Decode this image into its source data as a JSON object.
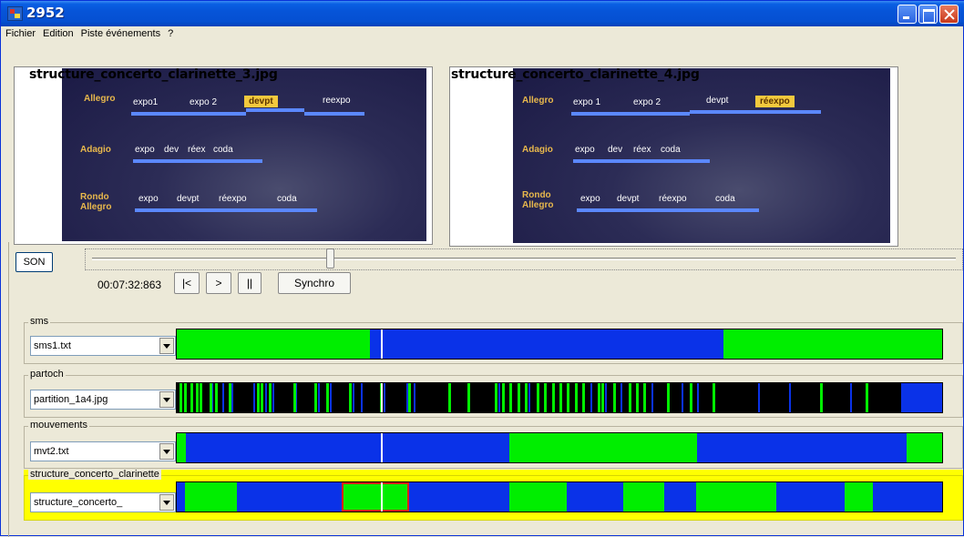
{
  "window": {
    "title": "2952",
    "icon": "app-icon"
  },
  "menu": [
    "Fichier",
    "Edition",
    "Piste événements",
    "?"
  ],
  "panels": [
    {
      "title": "structure_concerto_clarinette_3.jpg",
      "rows": [
        {
          "label1": "Allegro",
          "label2": "",
          "segments": [
            "expo1",
            "expo 2",
            "devpt",
            "reexpo"
          ],
          "active": 2
        },
        {
          "label1": "Adagio",
          "label2": "",
          "segments": [
            "expo",
            "dev",
            "réex",
            "coda"
          ],
          "active": -1
        },
        {
          "label1": "Rondo",
          "label2": "Allegro",
          "segments": [
            "expo",
            "devpt",
            "réexpo",
            "coda"
          ],
          "active": -1
        }
      ]
    },
    {
      "title": "structure_concerto_clarinette_4.jpg",
      "rows": [
        {
          "label1": "Allegro",
          "label2": "",
          "segments": [
            "expo 1",
            "expo 2",
            "devpt",
            "réexpo"
          ],
          "active": 3
        },
        {
          "label1": "Adagio",
          "label2": "",
          "segments": [
            "expo",
            "dev",
            "réex",
            "coda"
          ],
          "active": -1
        },
        {
          "label1": "Rondo",
          "label2": "Allegro",
          "segments": [
            "expo",
            "devpt",
            "réexpo",
            "coda"
          ],
          "active": -1
        }
      ]
    }
  ],
  "transport": {
    "son_label": "SON",
    "time": "00:07:32:863",
    "start_label": "|<",
    "play_label": ">",
    "pause_label": "||",
    "synchro_label": "Synchro",
    "position": 0.275
  },
  "colors": {
    "green": "#00ee00",
    "blue": "#0a32e8",
    "black": "#000000",
    "highlight": "#ffff00",
    "selection": "#e0201a"
  },
  "tracks": [
    {
      "label": "sms",
      "file": "sms1.txt",
      "segments": [
        {
          "from": 0,
          "to": 0.252,
          "color": "green"
        },
        {
          "from": 0.252,
          "to": 0.714,
          "color": "blue"
        },
        {
          "from": 0.714,
          "to": 1,
          "color": "green"
        }
      ],
      "cursor": 0.267
    },
    {
      "label": "partoch",
      "file": "partition_1a4.jpg",
      "segments": [
        {
          "from": 0,
          "to": 0.946,
          "color": "black"
        },
        {
          "from": 0.946,
          "to": 1,
          "color": "blue"
        }
      ],
      "green_lines": [
        0.004,
        0.01,
        0.018,
        0.025,
        0.03,
        0.043,
        0.05,
        0.068,
        0.105,
        0.11,
        0.12,
        0.152,
        0.18,
        0.195,
        0.225,
        0.265,
        0.302,
        0.355,
        0.38,
        0.415,
        0.425,
        0.435,
        0.445,
        0.455,
        0.47,
        0.48,
        0.49,
        0.5,
        0.51,
        0.52,
        0.53,
        0.55,
        0.555,
        0.57,
        0.59,
        0.6,
        0.61,
        0.64,
        0.67,
        0.7,
        0.84,
        0.9
      ],
      "blue_lines": [
        0.045,
        0.06,
        0.072,
        0.1,
        0.115,
        0.125,
        0.155,
        0.185,
        0.2,
        0.23,
        0.24,
        0.27,
        0.3,
        0.31,
        0.42,
        0.46,
        0.5,
        0.54,
        0.56,
        0.58,
        0.62,
        0.66,
        0.68,
        0.76,
        0.8,
        0.88
      ],
      "cursor": 0.267
    },
    {
      "label": "mouvements",
      "file": "mvt2.txt",
      "segments": [
        {
          "from": 0,
          "to": 0.012,
          "color": "green"
        },
        {
          "from": 0.012,
          "to": 0.435,
          "color": "blue"
        },
        {
          "from": 0.435,
          "to": 0.68,
          "color": "green"
        },
        {
          "from": 0.68,
          "to": 0.953,
          "color": "blue"
        },
        {
          "from": 0.953,
          "to": 1,
          "color": "green"
        }
      ],
      "cursor": 0.267
    },
    {
      "label": "structure_concerto_clarinette",
      "file": "structure_concerto_",
      "highlighted": true,
      "segments": [
        {
          "from": 0,
          "to": 0.011,
          "color": "blue"
        },
        {
          "from": 0.011,
          "to": 0.078,
          "color": "green"
        },
        {
          "from": 0.078,
          "to": 0.216,
          "color": "blue"
        },
        {
          "from": 0.216,
          "to": 0.304,
          "color": "green"
        },
        {
          "from": 0.304,
          "to": 0.435,
          "color": "blue"
        },
        {
          "from": 0.435,
          "to": 0.51,
          "color": "green"
        },
        {
          "from": 0.51,
          "to": 0.583,
          "color": "blue"
        },
        {
          "from": 0.583,
          "to": 0.637,
          "color": "green"
        },
        {
          "from": 0.637,
          "to": 0.678,
          "color": "blue"
        },
        {
          "from": 0.678,
          "to": 0.783,
          "color": "green"
        },
        {
          "from": 0.783,
          "to": 0.873,
          "color": "blue"
        },
        {
          "from": 0.873,
          "to": 0.91,
          "color": "green"
        },
        {
          "from": 0.91,
          "to": 1,
          "color": "blue"
        }
      ],
      "selected": {
        "from": 0.216,
        "to": 0.304
      },
      "cursor": 0.267
    }
  ]
}
